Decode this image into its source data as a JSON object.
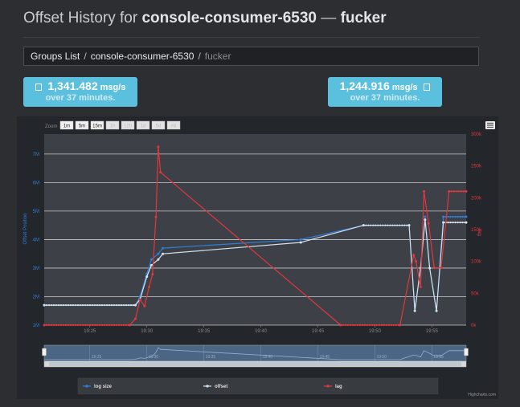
{
  "header": {
    "prefix": "Offset History for",
    "group": "console-consumer-6530",
    "dash": "—",
    "topic": "fucker"
  },
  "breadcrumb": {
    "root": "Groups List",
    "group": "console-consumer-6530",
    "current": "fucker"
  },
  "stats": {
    "produced": {
      "value": "1,341.482",
      "unit": "msg/s",
      "sub": "over 37 minutes.",
      "icon": "arrow-in-icon"
    },
    "consumed": {
      "value": "1,244.916",
      "unit": "msg/s",
      "sub": "over 37 minutes.",
      "icon": "arrow-out-icon"
    }
  },
  "chart": {
    "zoom_label": "Zoom",
    "zoom_buttons": [
      "1m",
      "5m",
      "15m",
      "1h",
      "12h",
      "1d",
      "5d",
      "All"
    ],
    "y_left_label": "Offset Position",
    "y_right_label": "lag",
    "y_left_ticks": [
      "1M",
      "2M",
      "3M",
      "4M",
      "5M",
      "6M",
      "7M"
    ],
    "y_right_ticks": [
      "0k",
      "50k",
      "100k",
      "150k",
      "200k",
      "250k",
      "300k"
    ],
    "x_ticks": [
      "19:25",
      "19:30",
      "19:35",
      "19:40",
      "19:45",
      "19:50",
      "19:55"
    ],
    "nav_ticks": [
      "19:25",
      "19:30",
      "19:35",
      "19:40",
      "19:45",
      "19:50",
      "19:55"
    ],
    "credits": "Highcharts.com",
    "colors": {
      "log_size": "#2f7ed8",
      "offset": "#d5e3ec",
      "lag": "#e0383d",
      "plot_bg": "#3d4047"
    }
  },
  "chart_data": {
    "type": "line",
    "xlim": [
      "19:21",
      "19:58"
    ],
    "ylim_left": [
      1000000,
      7700000
    ],
    "ylim_right": [
      0,
      300000
    ],
    "series": [
      {
        "name": "log size",
        "axis": "left",
        "x": [
          "19:21",
          "19:29",
          "19:29.4",
          "19:30",
          "19:30.4",
          "19:31",
          "19:31.4",
          "19:43.5",
          "19:49",
          "19:53",
          "19:53.5",
          "19:54",
          "19:54.4",
          "19:54.8",
          "19:55.4",
          "19:56",
          "19:58"
        ],
        "values": [
          1700000,
          1700000,
          2000000,
          2800000,
          3300000,
          3500000,
          3700000,
          4000000,
          4500000,
          4500000,
          1500000,
          3000000,
          4800000,
          3000000,
          1500000,
          4800000,
          4800000
        ]
      },
      {
        "name": "offset",
        "axis": "left",
        "x": [
          "19:21",
          "19:29",
          "19:29.4",
          "19:30",
          "19:30.4",
          "19:31",
          "19:31.4",
          "19:43.5",
          "19:49",
          "19:53",
          "19:53.5",
          "19:54",
          "19:54.4",
          "19:54.8",
          "19:55.4",
          "19:56",
          "19:58"
        ],
        "values": [
          1700000,
          1700000,
          1900000,
          2700000,
          3100000,
          3300000,
          3500000,
          3900000,
          4500000,
          4500000,
          1500000,
          3000000,
          4700000,
          3000000,
          1500000,
          4600000,
          4600000
        ]
      },
      {
        "name": "lag",
        "axis": "right",
        "x": [
          "19:21",
          "19:28.5",
          "19:29",
          "19:29.4",
          "19:29.8",
          "19:30.2",
          "19:30.5",
          "19:30.8",
          "19:31",
          "19:31.2",
          "19:47",
          "19:52.2",
          "19:53.4",
          "19:53.6",
          "19:54",
          "19:54.3",
          "19:54.7",
          "19:55.2",
          "19:55.8",
          "19:56.5",
          "19:58"
        ],
        "values": [
          0,
          0,
          10000,
          40000,
          30000,
          60000,
          80000,
          170000,
          280000,
          240000,
          0,
          0,
          110000,
          100000,
          60000,
          210000,
          160000,
          90000,
          90000,
          210000,
          210000
        ]
      }
    ],
    "legend_position": "bottom-center"
  },
  "legend": [
    {
      "label": "log size",
      "color": "#2f7ed8"
    },
    {
      "label": "offset",
      "color": "#d5e3ec"
    },
    {
      "label": "lag",
      "color": "#e0383d"
    }
  ]
}
